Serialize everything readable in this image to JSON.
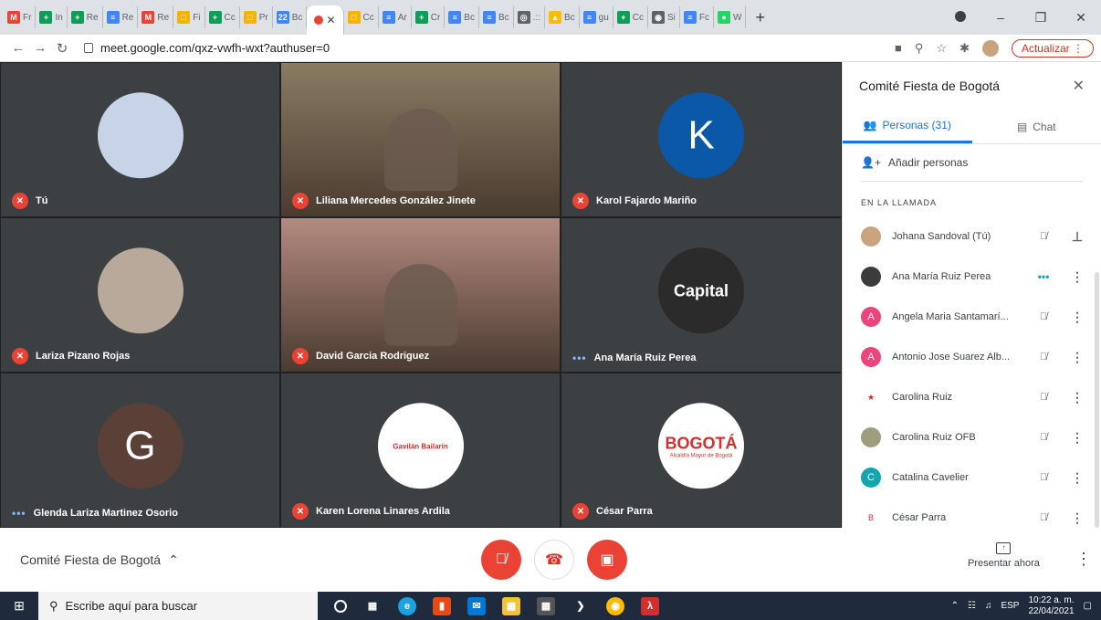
{
  "browser": {
    "tabs": [
      {
        "label": "Fr",
        "color": "#ea4335",
        "glyph": "M"
      },
      {
        "label": "In",
        "color": "#0f9d58",
        "glyph": "+"
      },
      {
        "label": "Re",
        "color": "#0f9d58",
        "glyph": "+"
      },
      {
        "label": "Re",
        "color": "#4285f4",
        "glyph": "≡"
      },
      {
        "label": "Re",
        "color": "#ea4335",
        "glyph": "M"
      },
      {
        "label": "Fi",
        "color": "#f4b400",
        "glyph": "□"
      },
      {
        "label": "Cc",
        "color": "#0f9d58",
        "glyph": "+"
      },
      {
        "label": "Pr",
        "color": "#f4b400",
        "glyph": "□"
      },
      {
        "label": "Bc",
        "color": "#4285f4",
        "glyph": "22"
      }
    ],
    "active_tab": {
      "label": "",
      "color": "#ea4335"
    },
    "tabs_after": [
      {
        "label": "Cc",
        "color": "#f4b400",
        "glyph": "□"
      },
      {
        "label": "Ar",
        "color": "#4285f4",
        "glyph": "≡"
      },
      {
        "label": "Cr",
        "color": "#0f9d58",
        "glyph": "+"
      },
      {
        "label": "Bc",
        "color": "#4285f4",
        "glyph": "≡"
      },
      {
        "label": "Bc",
        "color": "#4285f4",
        "glyph": "≡"
      },
      {
        "label": ".::",
        "color": "#5f6368",
        "glyph": "◎"
      },
      {
        "label": "Bc",
        "color": "#fbbc05",
        "glyph": "▲"
      },
      {
        "label": "gu",
        "color": "#4285f4",
        "glyph": "≡"
      },
      {
        "label": "Cc",
        "color": "#0f9d58",
        "glyph": "+"
      },
      {
        "label": "Si",
        "color": "#5f6368",
        "glyph": "◉"
      },
      {
        "label": "Fc",
        "color": "#4285f4",
        "glyph": "≡"
      },
      {
        "label": "W",
        "color": "#25d366",
        "glyph": "●"
      }
    ],
    "new_tab": "+",
    "url": "meet.google.com/qxz-vwfh-wxt?authuser=0",
    "update_label": "Actualizar"
  },
  "tiles": [
    {
      "name": "Tú",
      "muted": true,
      "kind": "avatar",
      "bg": "#c7d4e8",
      "letter": ""
    },
    {
      "name": "Liliana Mercedes González Jinete",
      "muted": true,
      "kind": "video",
      "bg": "#8a7b63"
    },
    {
      "name": "Karol Fajardo Mariño",
      "muted": true,
      "kind": "avatar",
      "bg": "#0b57a8",
      "letter": "K"
    },
    {
      "name": "Lariza Pizano Rojas",
      "muted": true,
      "kind": "avatar",
      "bg": "#b9a99a",
      "letter": ""
    },
    {
      "name": "David Garcia Rodriguez",
      "muted": true,
      "kind": "video",
      "bg": "#b48a80"
    },
    {
      "name": "Ana María Ruiz Perea",
      "muted": false,
      "kind": "avatar",
      "bg": "#2b2b2b",
      "letter": "",
      "badge": "Capital"
    },
    {
      "name": "Glenda Lariza Martinez Osorio",
      "muted": false,
      "kind": "avatar",
      "bg": "#5b4037",
      "letter": "G"
    },
    {
      "name": "Karen Lorena Linares Ardila",
      "muted": true,
      "kind": "avatar",
      "bg": "#ffffff",
      "letter": "",
      "badge": "Gavilán Bailarín"
    },
    {
      "name": "César Parra",
      "muted": true,
      "kind": "avatar",
      "bg": "#ffffff",
      "letter": "",
      "badge": "BOGOTÁ",
      "sub": "Alcaldía Mayor de Bogotá"
    }
  ],
  "panel": {
    "title": "Comité Fiesta de Bogotá",
    "tab_people": "Personas (31)",
    "tab_chat": "Chat",
    "add_people": "Añadir personas",
    "section": "EN LA LLAMADA",
    "people": [
      {
        "name": "Johana Sandoval (Tú)",
        "color": "#c9a27e",
        "letter": "",
        "status": "muted",
        "action": "pin"
      },
      {
        "name": "Ana María Ruiz Perea",
        "color": "#3c3c3c",
        "letter": "",
        "status": "speaking",
        "action": "menu"
      },
      {
        "name": "Angela Maria Santamarí...",
        "color": "#e8467c",
        "letter": "A",
        "status": "muted",
        "action": "menu"
      },
      {
        "name": "Antonio Jose Suarez Alb...",
        "color": "#e8467c",
        "letter": "A",
        "status": "muted",
        "action": "menu"
      },
      {
        "name": "Carolina Ruiz",
        "color": "#ffffff",
        "letter": "★",
        "status": "muted",
        "action": "menu"
      },
      {
        "name": "Carolina Ruiz OFB",
        "color": "#9e9e7e",
        "letter": "",
        "status": "muted",
        "action": "menu"
      },
      {
        "name": "Catalina Cavelier",
        "color": "#12a4af",
        "letter": "C",
        "status": "muted",
        "action": "menu"
      },
      {
        "name": "César Parra",
        "color": "#ffffff",
        "letter": "B",
        "status": "muted",
        "action": "menu"
      }
    ]
  },
  "controls": {
    "meeting_title": "Comité Fiesta de Bogotá",
    "present_label": "Presentar ahora"
  },
  "taskbar": {
    "search_placeholder": "Escribe aquí para buscar",
    "lang": "ESP",
    "time": "10:22 a. m.",
    "date": "22/04/2021"
  }
}
